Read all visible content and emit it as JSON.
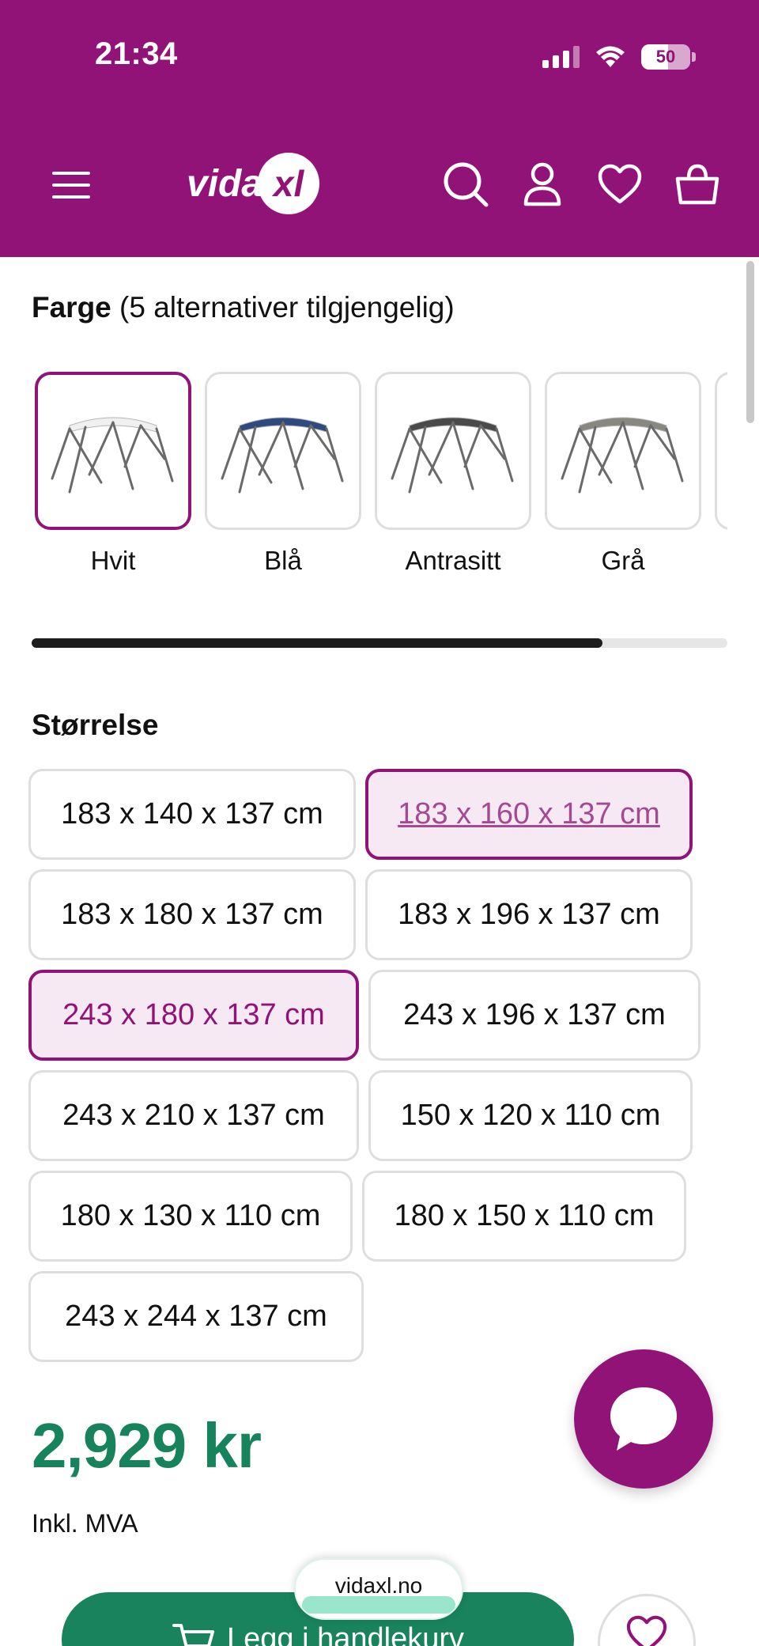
{
  "status_bar": {
    "time": "21:34",
    "battery": "50"
  },
  "header": {
    "logo_text": "vida",
    "logo_mark": "xl",
    "brand_color": "#921377",
    "icons": [
      "menu-icon",
      "search-icon",
      "user-icon",
      "heart-icon",
      "basket-icon"
    ]
  },
  "color_section": {
    "title": "Farge",
    "subtitle": "(5 alternativer tilgjengelig)",
    "options": [
      {
        "label": "Hvit",
        "canopy_color": "#f0f0f0",
        "selected": true
      },
      {
        "label": "Blå",
        "canopy_color": "#2f4a80",
        "selected": false
      },
      {
        "label": "Antrasitt",
        "canopy_color": "#4a4a4a",
        "selected": false
      },
      {
        "label": "Grå",
        "canopy_color": "#888780",
        "selected": false
      }
    ],
    "scroll_progress": 0.82
  },
  "size_section": {
    "title": "Størrelse",
    "options": [
      "183 x 140 x 137 cm",
      "183 x 160 x 137 cm",
      "183 x 180 x 137 cm",
      "183 x 196 x 137 cm",
      "243 x 180 x 137 cm",
      "243 x 196 x 137 cm",
      "243 x 210 x 137 cm",
      "150 x 120 x 110 cm",
      "180 x 130 x 110 cm",
      "180 x 150 x 110 cm",
      "243 x 244 x 137 cm"
    ],
    "selected": "243 x 180 x 137 cm",
    "highlighted_link": "183 x 160 x 137 cm"
  },
  "price": {
    "amount": "2,929 kr",
    "vat_note": "Inkl. MVA",
    "color": "#17835d"
  },
  "bottom": {
    "add_to_cart": "Legg i handlekurv",
    "url": "vidaxl.no"
  }
}
